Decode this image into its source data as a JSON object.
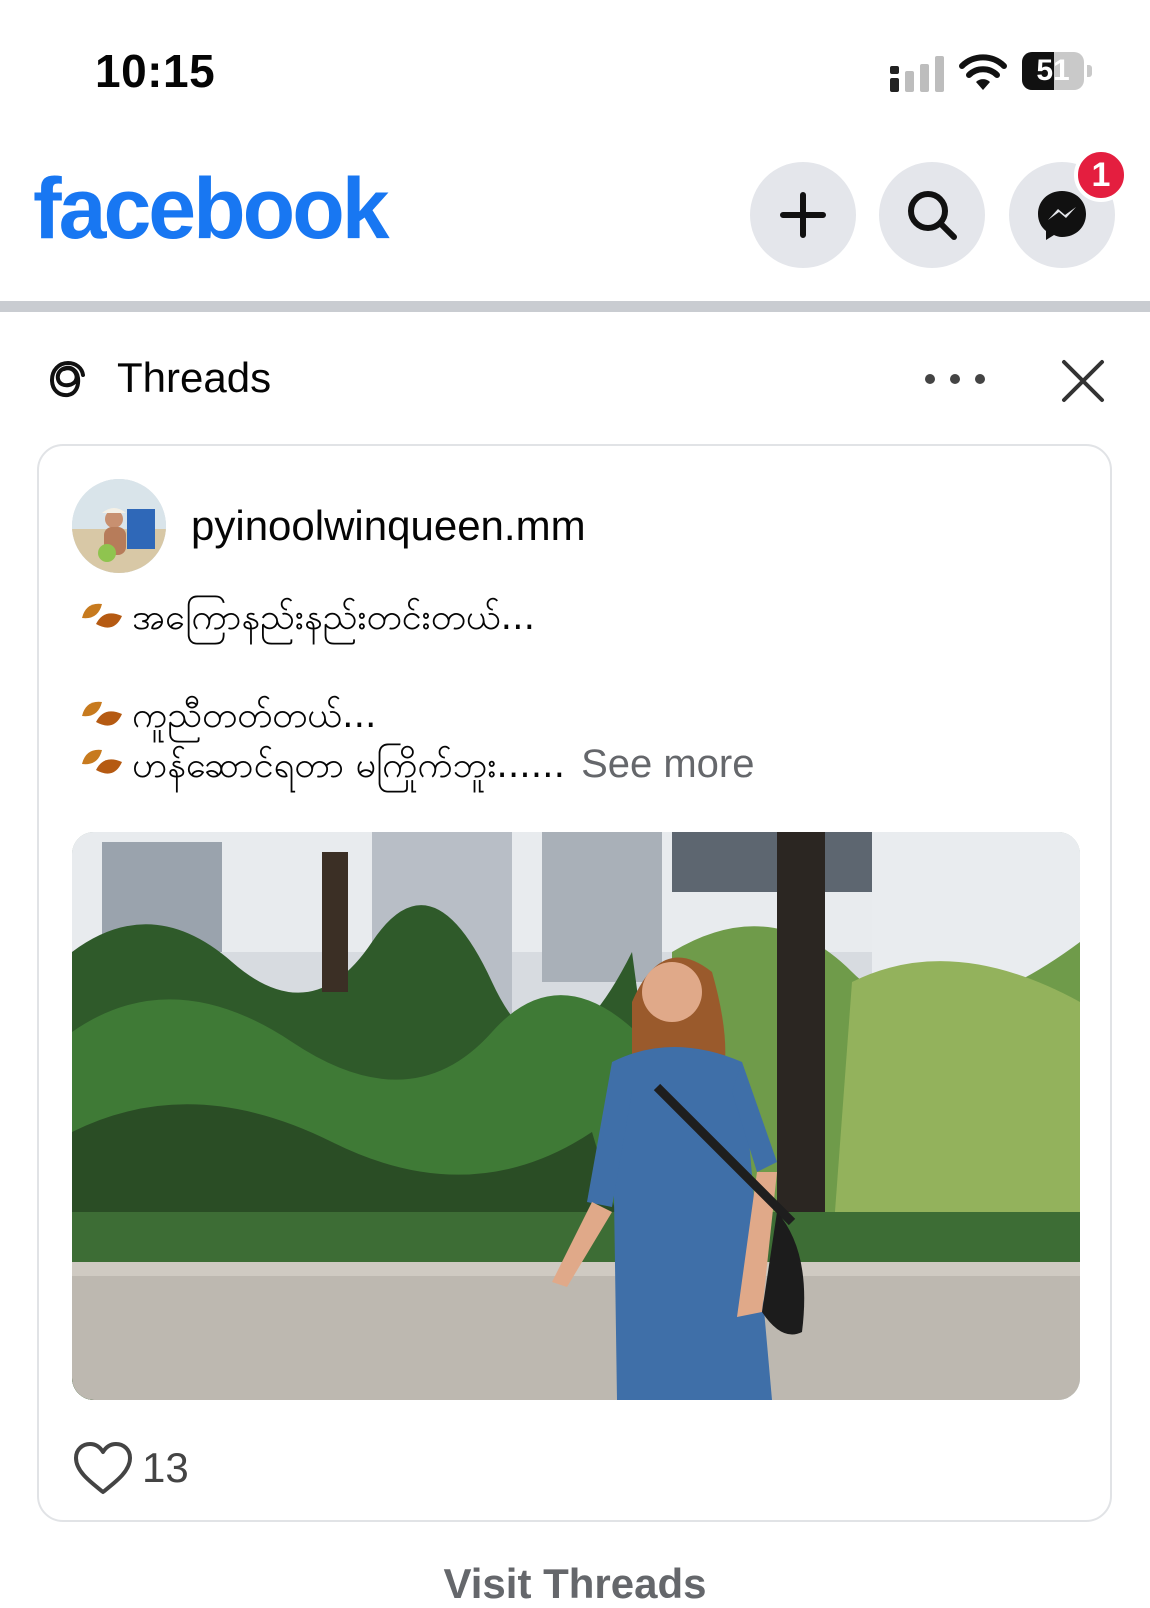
{
  "status_bar": {
    "time": "10:15",
    "battery": "51",
    "battery_level": 0.51
  },
  "header": {
    "logo": "facebook",
    "brand_color": "#1877f2",
    "create_icon": "plus-icon",
    "search_icon": "search-icon",
    "messenger_icon": "messenger-icon",
    "messenger_badge": "1"
  },
  "threads": {
    "title": "Threads",
    "icon": "threads-icon",
    "more_icon": "more-icon",
    "close_icon": "close-icon"
  },
  "post": {
    "username": "pyinoolwinqueen.mm",
    "lines": [
      "အကြောနည်းနည်းတင်းတယ်...",
      "ကူညီတတ်တယ်...",
      "ဟန်ဆောင်ရတာ မကြိုက်ဘူး......"
    ],
    "see_more": "See more",
    "like_icon": "heart-icon",
    "like_count": "13"
  },
  "footer": {
    "visit": "Visit Threads"
  }
}
